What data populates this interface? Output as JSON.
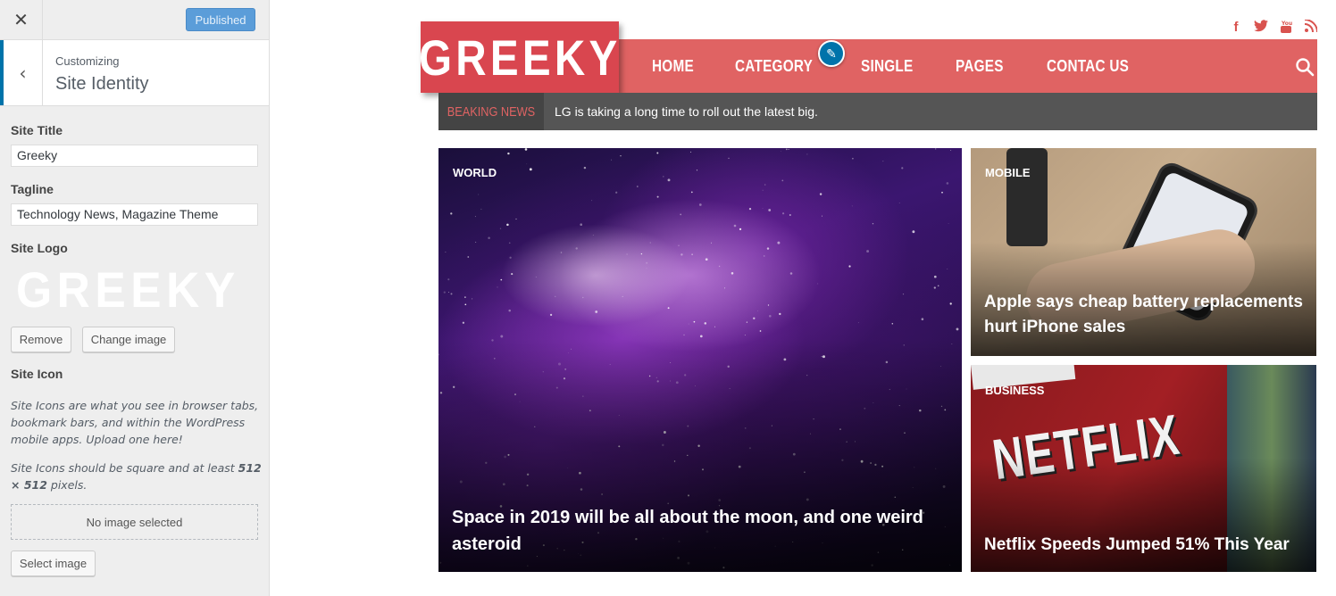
{
  "sidebar": {
    "close_icon": "close-icon",
    "publish_label": "Published",
    "back_icon": "chevron-left-icon",
    "customizing_label": "Customizing",
    "section_title": "Site Identity",
    "site_title_label": "Site Title",
    "site_title_value": "Greeky",
    "tagline_label": "Tagline",
    "tagline_value": "Technology News, Magazine Theme",
    "site_logo_label": "Site Logo",
    "logo_text": "GREEKY",
    "remove_label": "Remove",
    "change_image_label": "Change image",
    "site_icon_label": "Site Icon",
    "site_icon_desc1": "Site Icons are what you see in browser tabs, bookmark bars, and within the WordPress mobile apps. Upload one here!",
    "site_icon_desc2_pre": "Site Icons should be square and at least ",
    "site_icon_desc2_bold": "512 × 512",
    "site_icon_desc2_post": " pixels.",
    "no_image_label": "No image selected",
    "select_image_label": "Select image"
  },
  "preview": {
    "social_icons": [
      "facebook-icon",
      "twitter-icon",
      "youtube-icon",
      "rss-icon"
    ],
    "brand": "GREEKY",
    "nav": [
      "HOME",
      "CATEGORY",
      "SINGLE",
      "PAGES",
      "CONTAC US"
    ],
    "ticker_label": "BEAKING NEWS",
    "ticker_text": "LG is taking a long time to roll out the latest big.",
    "cards": [
      {
        "category": "WORLD",
        "title": "Space in 2019 will be all about the moon, and one weird asteroid"
      },
      {
        "category": "MOBILE",
        "title": "Apple says cheap battery replacements hurt iPhone sales"
      },
      {
        "category": "BUSINESS",
        "title": "Netflix Speeds Jumped 51% This Year",
        "image_text": "NETFLIX"
      }
    ]
  },
  "colors": {
    "nav_bg": "#e06363",
    "brand_bg": "#d9464f",
    "ticker_bg": "#555555",
    "publish_btn": "#5b9dd9",
    "accent_blue": "#0073aa"
  }
}
